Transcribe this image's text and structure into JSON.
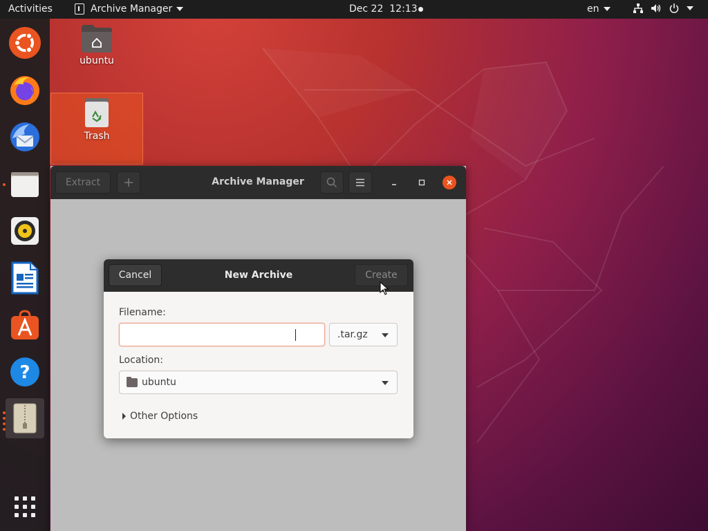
{
  "topbar": {
    "activities": "Activities",
    "app_menu_label": "Archive Manager",
    "clock": "Dec 22  12:13",
    "language": "en"
  },
  "dock": {
    "items": [
      {
        "name": "ubuntu-settings",
        "icon": "ubuntu-logo-icon"
      },
      {
        "name": "firefox",
        "icon": "firefox-icon"
      },
      {
        "name": "thunderbird",
        "icon": "thunderbird-icon"
      },
      {
        "name": "files",
        "icon": "files-icon",
        "running": true
      },
      {
        "name": "rhythmbox",
        "icon": "rhythmbox-icon"
      },
      {
        "name": "libreoffice-writer",
        "icon": "writer-icon"
      },
      {
        "name": "ubuntu-software",
        "icon": "software-icon"
      },
      {
        "name": "help",
        "icon": "help-icon"
      },
      {
        "name": "archive-manager",
        "icon": "archive-icon",
        "running": true,
        "active": true
      }
    ],
    "show_apps_icon": "grid-icon"
  },
  "desktop_icons": [
    {
      "label": "ubuntu",
      "icon": "home-folder-icon"
    },
    {
      "label": "Trash",
      "icon": "trash-icon",
      "selected": true
    }
  ],
  "window": {
    "title": "Archive Manager",
    "extract_label": "Extract",
    "add_icon": "plus-icon",
    "search_icon": "search-icon",
    "menu_icon": "hamburger-icon"
  },
  "dialog": {
    "title": "New Archive",
    "cancel_label": "Cancel",
    "create_label": "Create",
    "filename_label": "Filename:",
    "filename_value": "",
    "extension_value": ".tar.gz",
    "location_label": "Location:",
    "location_value": "ubuntu",
    "other_options_label": "Other Options"
  },
  "colors": {
    "accent": "#e95420",
    "panel": "#1d1d1d",
    "headerbar": "#2c2c2c",
    "dialog_bg": "#f6f5f4"
  }
}
